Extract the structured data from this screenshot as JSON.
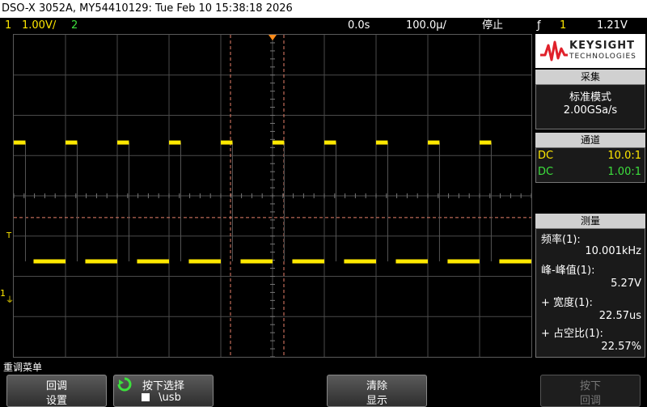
{
  "title": "DSO-X 3052A, MY54410129: Tue Feb 10 15:38:18 2026",
  "status": {
    "ch1_num": "1",
    "ch1_scale": "1.00V/",
    "ch2_num": "2",
    "time_delay": "0.0s",
    "time_scale": "100.0µ/",
    "run_state": "停止",
    "trigger_symbol": "ƒ",
    "trigger_source": "1",
    "trigger_level": "1.21V"
  },
  "left_markers": {
    "trigger_marker": "T",
    "ch1_marker": "1"
  },
  "logo": {
    "brand": "KEYSIGHT",
    "sub": "TECHNOLOGIES"
  },
  "acquisition": {
    "header": "采集",
    "mode": "标准模式",
    "rate": "2.00GSa/s"
  },
  "channels": {
    "header": "通道",
    "rows": [
      {
        "coupling": "DC",
        "probe": "10.0:1",
        "color": "#ffe800"
      },
      {
        "coupling": "DC",
        "probe": "1.00:1",
        "color": "#3de03d"
      }
    ]
  },
  "measurements": {
    "header": "测量",
    "items": [
      {
        "label": "频率(1):",
        "value": "10.001kHz"
      },
      {
        "label": "峰-峰值(1):",
        "value": "5.27V"
      },
      {
        "label": "+ 宽度(1):",
        "value": "22.57us"
      },
      {
        "label": "+ 占空比(1):",
        "value": "22.57%"
      }
    ]
  },
  "menu_label": "重调菜单",
  "softkeys": [
    {
      "line1": "回调",
      "line2": "设置"
    },
    {
      "line1": "按下选择",
      "line2": "\\usb"
    },
    {
      "line1": "清除",
      "line2": "显示"
    },
    {
      "line1": "按下",
      "line2": "回调"
    }
  ],
  "waveform": {
    "channel": "1",
    "frequency_khz": 10.001,
    "duty_cycle_percent": 22.57,
    "volts_per_div": 1.0,
    "peak_to_peak_v": 5.27,
    "trigger_level_v": 1.21,
    "time_per_div_us": 100.0,
    "color": "#ffe800"
  },
  "grid": {
    "h_divisions": 10,
    "v_divisions": 8,
    "trace_color": "#ffe800",
    "grid_color": "#4a4a4a",
    "cursor_color": "#e8806a"
  }
}
